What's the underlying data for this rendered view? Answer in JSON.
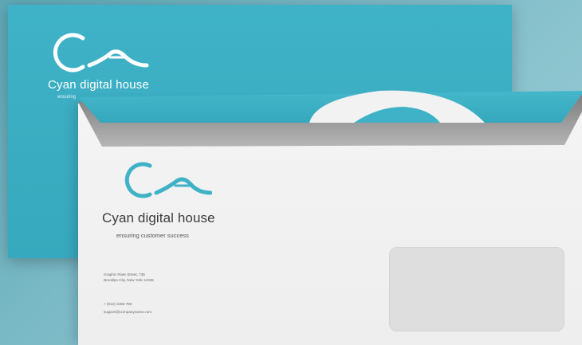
{
  "company": {
    "name": "Cyan digital house",
    "tagline": "ensuring customer success"
  },
  "back_envelope": {
    "name": "Cyan digital house",
    "tagline": "ensuring"
  },
  "contact": {
    "street": "Graphic River Street, 735",
    "city": "Brooklyn City, New York 12345",
    "phone": "+ (012) 3456 789",
    "email": "support@companyname.com"
  },
  "colors": {
    "brand": "#3fb2c7",
    "envelope_white": "#f0f0f0",
    "background": "#7fbcc8"
  },
  "icons": [
    "cyan-logo-icon"
  ]
}
